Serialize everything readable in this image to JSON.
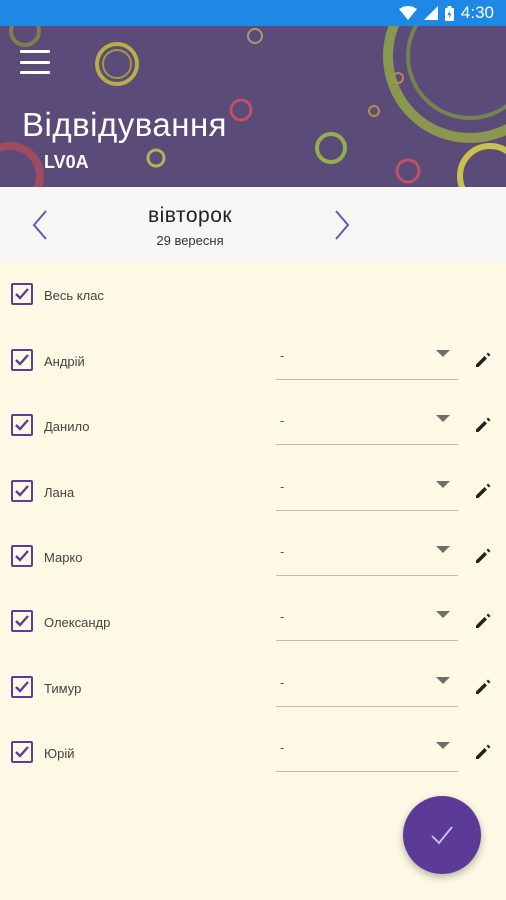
{
  "status_bar": {
    "time": "4:30"
  },
  "header": {
    "title": "Відвідування",
    "class_code": "LV0A"
  },
  "date_nav": {
    "day": "вівторок",
    "date": "29 вересня"
  },
  "select_all": {
    "label": "Весь клас",
    "checked": true
  },
  "students": [
    {
      "name": "Андрій",
      "status": "-",
      "checked": true
    },
    {
      "name": "Данило",
      "status": "-",
      "checked": true
    },
    {
      "name": "Лана",
      "status": "-",
      "checked": true
    },
    {
      "name": "Марко",
      "status": "-",
      "checked": true
    },
    {
      "name": "Олександр",
      "status": "-",
      "checked": true
    },
    {
      "name": "Тимур",
      "status": "-",
      "checked": true
    },
    {
      "name": "Юрій",
      "status": "-",
      "checked": true
    }
  ],
  "colors": {
    "status_bar": "#1e88e5",
    "header": "#5a4b78",
    "accent": "#5b3a98",
    "background": "#fdf9e4"
  }
}
